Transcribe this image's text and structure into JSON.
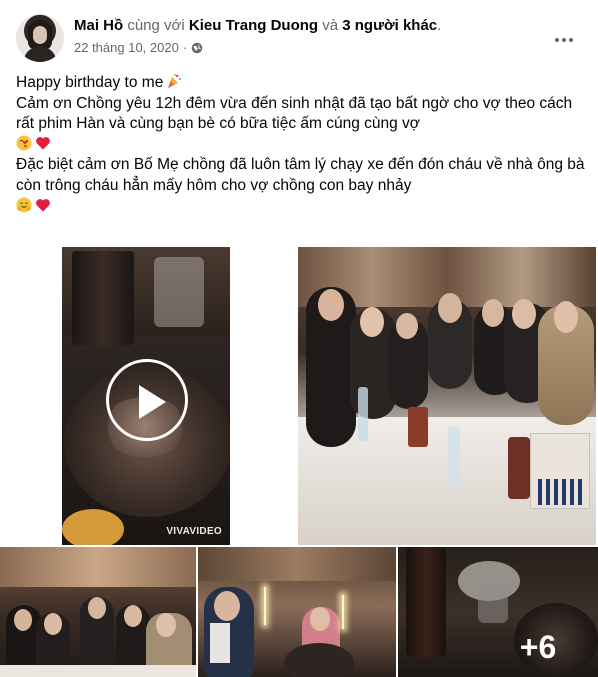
{
  "header": {
    "author": "Mai Hồ",
    "with_word": "cùng với",
    "tagged": "Kieu Trang Duong",
    "and_word": "và",
    "others": "3 người khác",
    "period": ".",
    "date": "22 tháng 10, 2020",
    "separator": "·",
    "privacy_icon": "globe-icon",
    "more_icon": "more-dots-icon"
  },
  "post": {
    "lines": [
      "Happy birthday to me",
      "Cảm ơn Chồng yêu 12h đêm vừa đến sinh nhật đã tạo bất ngờ cho vợ theo cách rất phim Hàn và cùng bạn bè có bữa tiệc ấm cúng cùng vợ",
      "Đặc biệt cảm ơn Bố Mẹ chồng đã luôn tâm lý chạy xe đến đón cháu về nhà ông bà còn trông cháu hẳn mấy hôm cho vợ chồng con bay nhảy"
    ],
    "emojis": [
      "party-popper-emoji",
      "kiss-face-emoji",
      "red-heart-emoji",
      "hugging-face-emoji",
      "red-heart-emoji"
    ]
  },
  "media": {
    "video_watermark": "VIVAVIDEO",
    "more_count": "+6",
    "play_icon": "play-icon"
  },
  "colors": {
    "text": "#050505",
    "muted": "#65676b",
    "heart": "#e41e3f"
  }
}
